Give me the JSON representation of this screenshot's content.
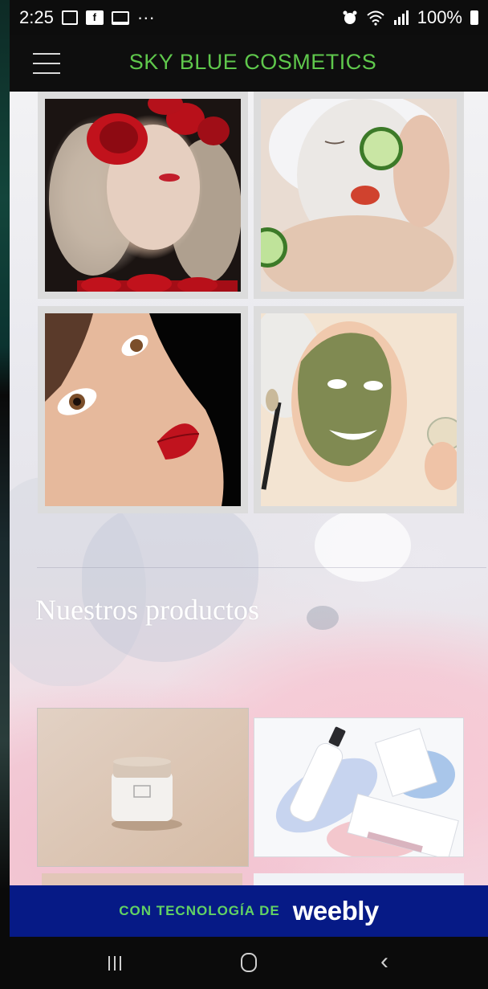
{
  "status_bar": {
    "time": "2:25",
    "more": "···",
    "battery": "100%"
  },
  "header": {
    "title": "SKY BLUE COSMETICS"
  },
  "gallery": {
    "items": [
      {
        "name": "roses-portrait"
      },
      {
        "name": "cucumber-mask"
      },
      {
        "name": "red-lips-portrait"
      },
      {
        "name": "green-clay-mask"
      }
    ]
  },
  "products_section": {
    "heading": "Nuestros productos"
  },
  "weebly_banner": {
    "label": "CON TECNOLOGÍA DE",
    "logo": "weebly"
  },
  "colors": {
    "title_green": "#5fc84c",
    "banner_blue": "#061a86",
    "banner_text_green": "#62d264"
  }
}
